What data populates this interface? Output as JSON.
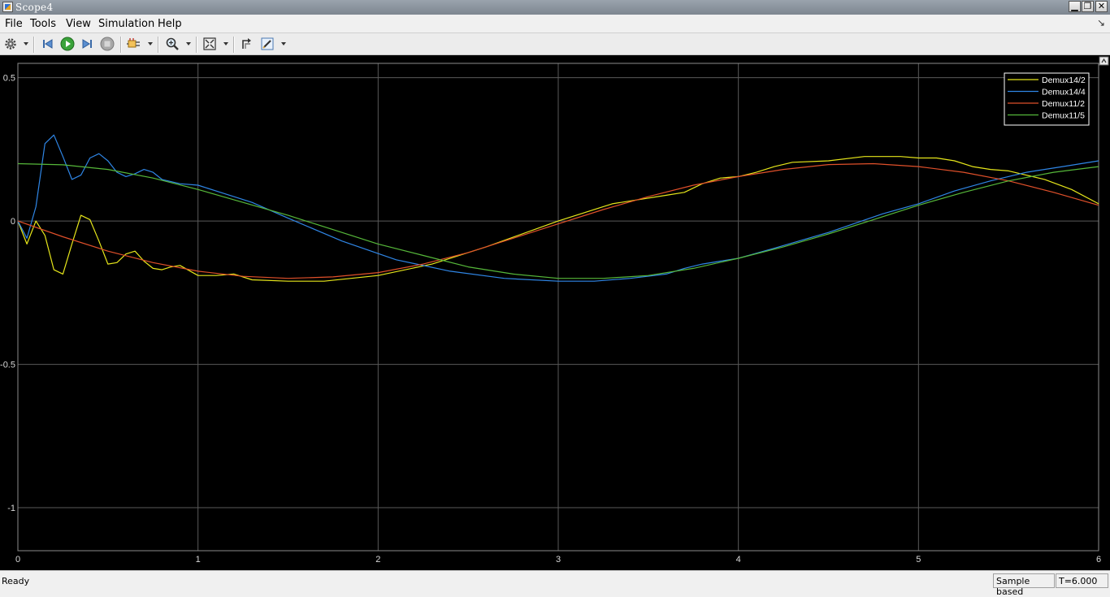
{
  "window": {
    "title": "Scope4"
  },
  "menu": [
    "File",
    "Tools",
    "View",
    "Simulation",
    "Help"
  ],
  "toolbar": {
    "buttons": [
      "gear-icon",
      "step-back-icon",
      "run-icon",
      "step-forward-icon",
      "stop-icon",
      "signal-select-icon",
      "zoom-icon",
      "autoscale-icon",
      "restore-view-icon",
      "edit-icon"
    ]
  },
  "status": {
    "left": "Ready",
    "mode": "Sample based",
    "time": "T=6.000"
  },
  "colors": {
    "Demux14/2": "#e6e61a",
    "Demux14/4": "#2f86e6",
    "Demux11/2": "#e0502a",
    "Demux11/5": "#56b83a"
  },
  "chart_data": {
    "type": "line",
    "title": "",
    "xlabel": "",
    "ylabel": "",
    "xlim": [
      0,
      6
    ],
    "ylim": [
      -1.15,
      0.55
    ],
    "xticks": [
      "0",
      "1",
      "2",
      "3",
      "4",
      "5",
      "6"
    ],
    "yticks": [
      "0.5",
      "0",
      "-0.5",
      "-1"
    ],
    "grid": true,
    "legend_position": "top-right",
    "background": "#000000",
    "series": [
      {
        "name": "Demux14/2",
        "color": "#e6e61a",
        "x": [
          0,
          0.05,
          0.1,
          0.15,
          0.2,
          0.25,
          0.3,
          0.35,
          0.4,
          0.45,
          0.5,
          0.55,
          0.6,
          0.65,
          0.7,
          0.75,
          0.8,
          0.85,
          0.9,
          1.0,
          1.1,
          1.2,
          1.3,
          1.5,
          1.7,
          2.0,
          2.3,
          2.6,
          3.0,
          3.3,
          3.6,
          3.7,
          3.8,
          3.9,
          4.0,
          4.1,
          4.2,
          4.3,
          4.5,
          4.7,
          4.9,
          5.0,
          5.1,
          5.2,
          5.3,
          5.4,
          5.5,
          5.7,
          5.85,
          6.0
        ],
        "values": [
          0,
          -0.08,
          0,
          -0.05,
          -0.17,
          -0.185,
          -0.08,
          0.02,
          0.005,
          -0.07,
          -0.15,
          -0.145,
          -0.115,
          -0.105,
          -0.14,
          -0.165,
          -0.17,
          -0.16,
          -0.155,
          -0.19,
          -0.19,
          -0.185,
          -0.205,
          -0.21,
          -0.21,
          -0.19,
          -0.15,
          -0.09,
          0.0,
          0.06,
          0.09,
          0.1,
          0.13,
          0.15,
          0.155,
          0.17,
          0.19,
          0.205,
          0.21,
          0.225,
          0.225,
          0.22,
          0.22,
          0.21,
          0.19,
          0.18,
          0.175,
          0.145,
          0.11,
          0.06
        ]
      },
      {
        "name": "Demux14/4",
        "color": "#2f86e6",
        "x": [
          0,
          0.05,
          0.1,
          0.15,
          0.2,
          0.25,
          0.3,
          0.35,
          0.4,
          0.45,
          0.5,
          0.55,
          0.6,
          0.65,
          0.7,
          0.75,
          0.8,
          0.9,
          1.0,
          1.1,
          1.3,
          1.5,
          1.8,
          2.1,
          2.4,
          2.7,
          3.0,
          3.2,
          3.4,
          3.6,
          3.7,
          3.8,
          3.9,
          4.0,
          4.2,
          4.5,
          4.8,
          5.0,
          5.2,
          5.4,
          5.6,
          5.8,
          6.0
        ],
        "values": [
          0,
          -0.06,
          0.05,
          0.27,
          0.3,
          0.225,
          0.145,
          0.16,
          0.22,
          0.235,
          0.21,
          0.17,
          0.155,
          0.165,
          0.18,
          0.17,
          0.145,
          0.13,
          0.125,
          0.105,
          0.065,
          0.01,
          -0.07,
          -0.135,
          -0.175,
          -0.2,
          -0.21,
          -0.21,
          -0.2,
          -0.185,
          -0.165,
          -0.15,
          -0.14,
          -0.13,
          -0.095,
          -0.04,
          0.025,
          0.06,
          0.105,
          0.14,
          0.17,
          0.19,
          0.21
        ]
      },
      {
        "name": "Demux11/2",
        "color": "#e0502a",
        "x": [
          0,
          0.25,
          0.5,
          0.75,
          1.0,
          1.25,
          1.5,
          1.75,
          2.0,
          2.25,
          2.5,
          2.75,
          3.0,
          3.25,
          3.5,
          3.75,
          4.0,
          4.25,
          4.5,
          4.75,
          5.0,
          5.25,
          5.5,
          5.75,
          6.0
        ],
        "values": [
          0,
          -0.055,
          -0.105,
          -0.145,
          -0.175,
          -0.193,
          -0.2,
          -0.195,
          -0.18,
          -0.15,
          -0.11,
          -0.06,
          -0.01,
          0.04,
          0.085,
          0.125,
          0.155,
          0.18,
          0.197,
          0.2,
          0.19,
          0.17,
          0.14,
          0.1,
          0.055
        ]
      },
      {
        "name": "Demux11/5",
        "color": "#56b83a",
        "x": [
          0,
          0.25,
          0.5,
          0.75,
          1.0,
          1.25,
          1.5,
          1.75,
          2.0,
          2.25,
          2.5,
          2.75,
          3.0,
          3.25,
          3.5,
          3.75,
          4.0,
          4.25,
          4.5,
          4.75,
          5.0,
          5.25,
          5.5,
          5.75,
          6.0
        ],
        "values": [
          0.2,
          0.196,
          0.18,
          0.15,
          0.11,
          0.065,
          0.02,
          -0.03,
          -0.08,
          -0.12,
          -0.16,
          -0.185,
          -0.2,
          -0.2,
          -0.19,
          -0.165,
          -0.13,
          -0.09,
          -0.045,
          0.005,
          0.055,
          0.1,
          0.14,
          0.17,
          0.19
        ]
      }
    ]
  }
}
